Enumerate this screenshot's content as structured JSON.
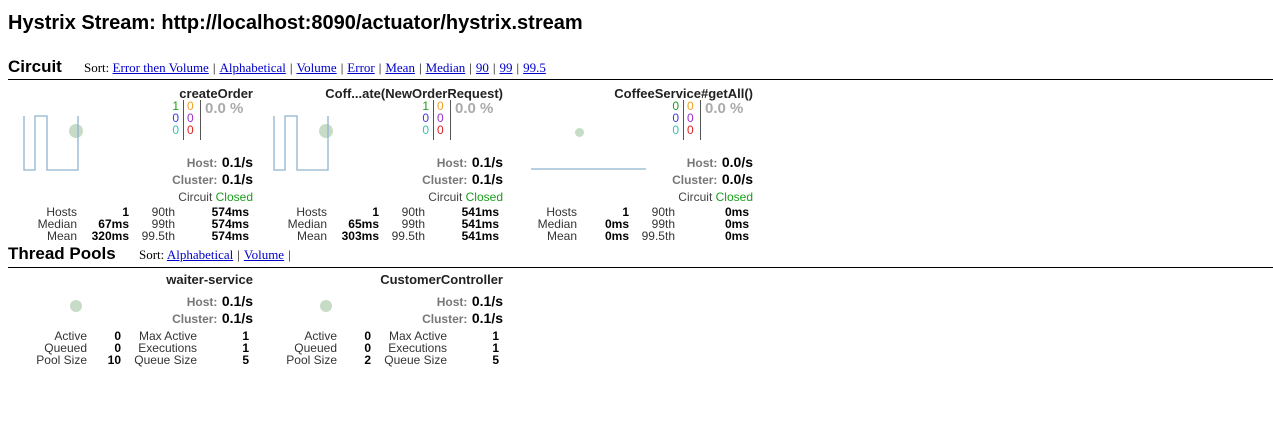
{
  "page": {
    "title": "Hystrix Stream: http://localhost:8090/actuator/hystrix.stream"
  },
  "circuit_section": {
    "title": "Circuit",
    "sort_label": "Sort:",
    "sort_options": [
      "Error then Volume",
      "Alphabetical",
      "Volume",
      "Error",
      "Mean",
      "Median",
      "90",
      "99",
      "99.5"
    ]
  },
  "circuits": [
    {
      "name": "createOrder",
      "counts": {
        "success": "1",
        "short_circuited": "0",
        "bad_request": "0",
        "timeout": "0",
        "rejected": "0",
        "failure": "0"
      },
      "error_pct": "0.0 %",
      "host_label": "Host:",
      "host_rate": "0.1/s",
      "cluster_label": "Cluster:",
      "cluster_rate": "0.1/s",
      "circuit_label": "Circuit",
      "circuit_status": "Closed",
      "stats": {
        "hosts_label": "Hosts",
        "hosts": "1",
        "median_label": "Median",
        "median": "67ms",
        "mean_label": "Mean",
        "mean": "320ms",
        "p90_label": "90th",
        "p90": "574ms",
        "p99_label": "99th",
        "p99": "574ms",
        "p995_label": "99.5th",
        "p995": "574ms"
      }
    },
    {
      "name": "Coff...ate(NewOrderRequest)",
      "counts": {
        "success": "1",
        "short_circuited": "0",
        "bad_request": "0",
        "timeout": "0",
        "rejected": "0",
        "failure": "0"
      },
      "error_pct": "0.0 %",
      "host_label": "Host:",
      "host_rate": "0.1/s",
      "cluster_label": "Cluster:",
      "cluster_rate": "0.1/s",
      "circuit_label": "Circuit",
      "circuit_status": "Closed",
      "stats": {
        "hosts_label": "Hosts",
        "hosts": "1",
        "median_label": "Median",
        "median": "65ms",
        "mean_label": "Mean",
        "mean": "303ms",
        "p90_label": "90th",
        "p90": "541ms",
        "p99_label": "99th",
        "p99": "541ms",
        "p995_label": "99.5th",
        "p995": "541ms"
      }
    },
    {
      "name": "CoffeeService#getAll()",
      "counts": {
        "success": "0",
        "short_circuited": "0",
        "bad_request": "0",
        "timeout": "0",
        "rejected": "0",
        "failure": "0"
      },
      "error_pct": "0.0 %",
      "host_label": "Host:",
      "host_rate": "0.0/s",
      "cluster_label": "Cluster:",
      "cluster_rate": "0.0/s",
      "circuit_label": "Circuit",
      "circuit_status": "Closed",
      "stats": {
        "hosts_label": "Hosts",
        "hosts": "1",
        "median_label": "Median",
        "median": "0ms",
        "mean_label": "Mean",
        "mean": "0ms",
        "p90_label": "90th",
        "p90": "0ms",
        "p99_label": "99th",
        "p99": "0ms",
        "p995_label": "99.5th",
        "p995": "0ms"
      }
    }
  ],
  "threadpool_section": {
    "title": "Thread Pools",
    "sort_label": "Sort:",
    "sort_options": [
      "Alphabetical",
      "Volume"
    ]
  },
  "threadpools": [
    {
      "name": "waiter-service",
      "host_label": "Host:",
      "host_rate": "0.1/s",
      "cluster_label": "Cluster:",
      "cluster_rate": "0.1/s",
      "stats": {
        "active_label": "Active",
        "active": "0",
        "queued_label": "Queued",
        "queued": "0",
        "pool_size_label": "Pool Size",
        "pool_size": "10",
        "max_active_label": "Max Active",
        "max_active": "1",
        "executions_label": "Executions",
        "executions": "1",
        "queue_size_label": "Queue Size",
        "queue_size": "5"
      }
    },
    {
      "name": "CustomerController",
      "host_label": "Host:",
      "host_rate": "0.1/s",
      "cluster_label": "Cluster:",
      "cluster_rate": "0.1/s",
      "stats": {
        "active_label": "Active",
        "active": "0",
        "queued_label": "Queued",
        "queued": "0",
        "pool_size_label": "Pool Size",
        "pool_size": "2",
        "max_active_label": "Max Active",
        "max_active": "1",
        "executions_label": "Executions",
        "executions": "1",
        "queue_size_label": "Queue Size",
        "queue_size": "5"
      }
    }
  ],
  "colors": {
    "success": "#1a9e1a",
    "short_circuited": "#3a3ae0",
    "bad_request": "#2ec4b6",
    "timeout": "#f0a020",
    "rejected": "#9b30c9",
    "failure": "#e02020",
    "closed": "#1a9e1a",
    "sparkline": "#8fb3cf",
    "health_circle": "#c7dcc7"
  }
}
